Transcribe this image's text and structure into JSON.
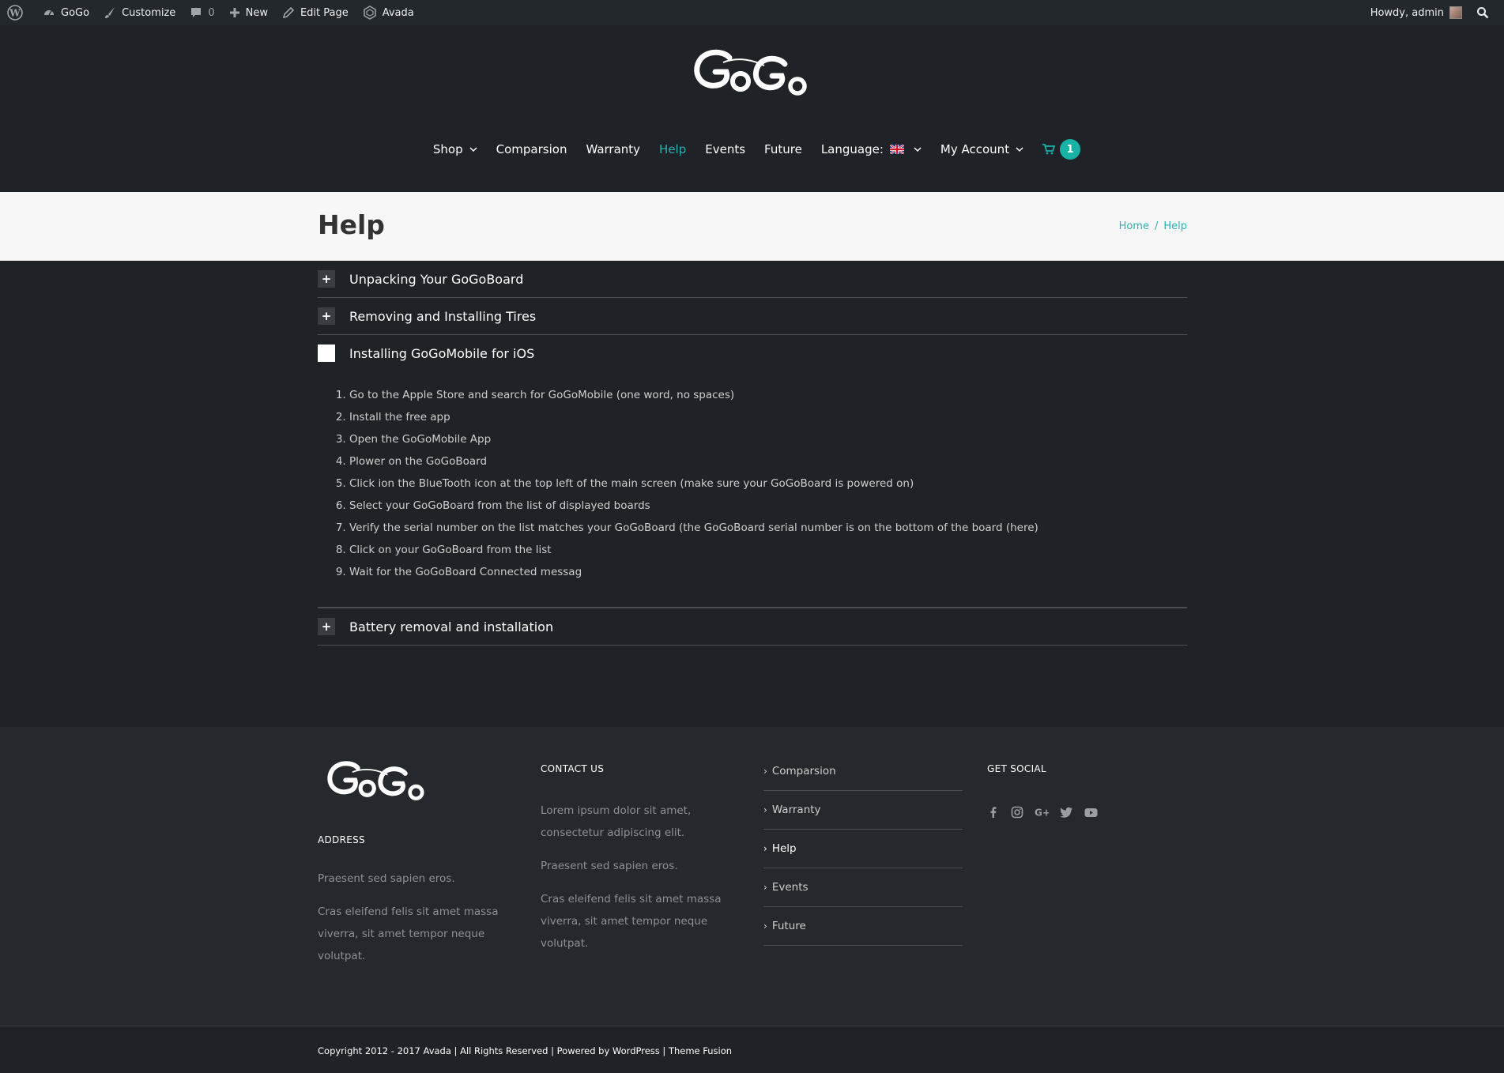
{
  "admin_bar": {
    "items": [
      {
        "label": "GoGo",
        "icon": "dashboard-icon"
      },
      {
        "label": "Customize",
        "icon": "brush-icon"
      },
      {
        "label": "0",
        "icon": "comment-icon"
      },
      {
        "label": "New",
        "icon": "plus-icon"
      },
      {
        "label": "Edit Page",
        "icon": "pencil-icon"
      },
      {
        "label": "Avada",
        "icon": "avada-icon"
      }
    ],
    "howdy": "Howdy, admin"
  },
  "nav": {
    "items": [
      "Shop",
      "Comparsion",
      "Warranty",
      "Help",
      "Events",
      "Future",
      "Language:",
      "My Account"
    ],
    "active": "Help",
    "cart_count": "1"
  },
  "title_bar": {
    "title": "Help",
    "breadcrumb": [
      "Home",
      "Help"
    ],
    "separator": "/"
  },
  "accordion": [
    {
      "title": "Unpacking Your GoGoBoard",
      "open": false
    },
    {
      "title": "Removing and Installing Tires",
      "open": false
    },
    {
      "title": "Installing GoGoMobile for iOS",
      "open": true,
      "steps": [
        "Go to the Apple Store and search for GoGoMobile (one word, no spaces)",
        "Install the free app",
        "Open the GoGoMobile App",
        "Plower on the GoGoBoard",
        "Click ion the BlueTooth icon at the top left of the main screen (make sure your GoGoBoard is powered on)",
        "Select your GoGoBoard from the list of displayed boards",
        "Verify the serial number on the list matches your GoGoBoard (the GoGoBoard serial number is on the bottom of the board (here)",
        "Click on your GoGoBoard from the list",
        "Wait for the GoGoBoard Connected messag"
      ]
    },
    {
      "title": "Battery removal and installation",
      "open": false
    }
  ],
  "footer": {
    "address_heading": "ADDRESS",
    "address_lines": [
      "Praesent sed sapien eros.",
      "Cras eleifend felis sit amet massa viverra, sit amet tempor neque volutpat."
    ],
    "contact_heading": "CONTACT US",
    "contact_lines": [
      "Lorem ipsum dolor sit amet, consectetur adipiscing elit.",
      "Praesent sed sapien eros.",
      "Cras eleifend felis sit amet massa viverra, sit amet tempor neque volutpat."
    ],
    "links": [
      "Comparsion",
      "Warranty",
      "Help",
      "Events",
      "Future"
    ],
    "active_link": "Help",
    "social_heading": "GET SOCIAL",
    "social_icons": [
      "facebook-icon",
      "instagram-icon",
      "google-plus-icon",
      "twitter-icon",
      "youtube-icon"
    ],
    "copyright": "Copyright 2012 - 2017 Avada | All Rights Reserved | Powered by WordPress | Theme Fusion"
  },
  "colors": {
    "accent": "#2ab0b4",
    "background": "#1f2226",
    "footer": "#25282c"
  }
}
